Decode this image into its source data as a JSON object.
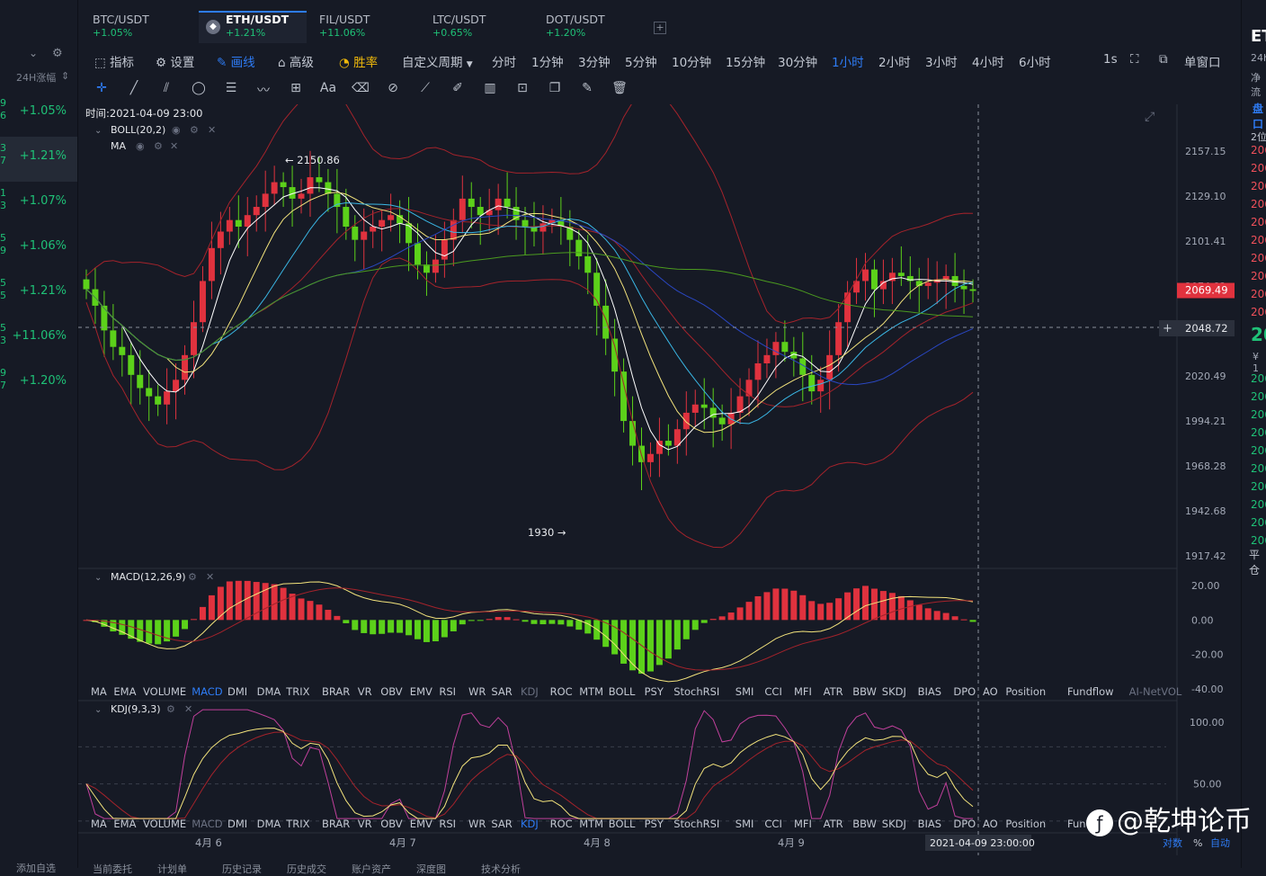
{
  "left_panel": {
    "sort_label": "24H涨幅",
    "rows": [
      {
        "edge": "9\n6",
        "change": "+1.05%"
      },
      {
        "edge": "3\n7",
        "change": "+1.21%",
        "selected": true
      },
      {
        "edge": "1\n3",
        "change": "+1.07%"
      },
      {
        "edge": "5\n9",
        "change": "+1.06%"
      },
      {
        "edge": "5\n5",
        "change": "+1.21%"
      },
      {
        "edge": "5\n3",
        "change": "+11.06%"
      },
      {
        "edge": "9\n7",
        "change": "+1.20%"
      }
    ],
    "footer": "添加自选"
  },
  "top_tabs": [
    {
      "name": "BTC/USDT",
      "change": "+1.05%"
    },
    {
      "name": "ETH/USDT",
      "change": "+1.21%",
      "active": true
    },
    {
      "name": "FIL/USDT",
      "change": "+11.06%"
    },
    {
      "name": "LTC/USDT",
      "change": "+0.65%"
    },
    {
      "name": "DOT/USDT",
      "change": "+1.20%"
    }
  ],
  "add_tab": "+",
  "toolbar": {
    "indicator": "指标",
    "settings": "设置",
    "draw": "画线",
    "advanced": "高级",
    "winrate": "胜率",
    "custom_period": "自定义周期",
    "periods": [
      "分时",
      "1分钟",
      "3分钟",
      "5分钟",
      "10分钟",
      "15分钟",
      "30分钟",
      "1小时",
      "2小时",
      "3小时",
      "4小时",
      "6小时"
    ],
    "active_period": "1小时",
    "interval": "1s",
    "single_window": "单窗口"
  },
  "draw_tools": [
    "crosshair",
    "line",
    "parallel",
    "circle",
    "hlines",
    "wave",
    "measure",
    "text",
    "eraser",
    "magnet",
    "ruler",
    "brush",
    "candles",
    "lock",
    "copy",
    "edit",
    "trash"
  ],
  "draw_text_tool": "Aa",
  "chart": {
    "time_label": "时间:2021-04-09 23:00",
    "boll_label": "BOLL(20,2)",
    "ma_label": "MA",
    "high_marker": "← 2150.86",
    "low_marker": "1930 →",
    "price_ticks": [
      "2157.15",
      "2129.10",
      "2101.41",
      "2074.82",
      "2048.72",
      "2020.49",
      "1994.21",
      "1968.28",
      "1942.68",
      "1917.42"
    ],
    "current_price": "2069.49",
    "crosshair_price": "2048.72",
    "macd_label": "MACD(12,26,9)",
    "macd_ticks": [
      "20.00",
      "0.00",
      "-20.00",
      "-40.00"
    ],
    "kdj_label": "KDJ(9,3,3)",
    "kdj_ticks": [
      "100.00",
      "50.00"
    ],
    "indicator_bar_1": [
      "MA",
      "EMA",
      "VOLUME",
      "MACD",
      "DMI",
      "DMA",
      "TRIX",
      "BRAR",
      "VR",
      "OBV",
      "EMV",
      "RSI",
      "WR",
      "SAR",
      "KDJ",
      "ROC",
      "MTM",
      "BOLL",
      "PSY",
      "StochRSI",
      "SMI",
      "CCI",
      "MFI",
      "ATR",
      "BBW",
      "SKDJ",
      "BIAS",
      "DPO",
      "AO",
      "Position",
      "Fundflow",
      "AI-NetVOL"
    ],
    "indicator_bar_1_active": "MACD",
    "indicator_bar_2": [
      "MA",
      "EMA",
      "VOLUME",
      "MACD",
      "DMI",
      "DMA",
      "TRIX",
      "BRAR",
      "VR",
      "OBV",
      "EMV",
      "RSI",
      "WR",
      "SAR",
      "KDJ",
      "ROC",
      "MTM",
      "BOLL",
      "PSY",
      "StochRSI",
      "SMI",
      "CCI",
      "MFI",
      "ATR",
      "BBW",
      "SKDJ",
      "BIAS",
      "DPO",
      "AO",
      "Position",
      "Fund"
    ],
    "indicator_bar_2_active": "KDJ",
    "dates": [
      "4月 6",
      "4月 7",
      "4月 8",
      "4月 9"
    ],
    "crosshair_time": "2021-04-09 23:00:00",
    "scale_log": "对数",
    "scale_pct": "%",
    "scale_auto": "自动"
  },
  "chart_data": {
    "type": "candlestick",
    "interval": "1h",
    "ohlc_approx_close": [
      2070,
      2060,
      2045,
      2035,
      2030,
      2018,
      2010,
      2005,
      2000,
      2008,
      2015,
      2030,
      2050,
      2075,
      2095,
      2105,
      2112,
      2108,
      2115,
      2120,
      2128,
      2135,
      2132,
      2125,
      2128,
      2138,
      2135,
      2128,
      2120,
      2108,
      2100,
      2105,
      2108,
      2112,
      2115,
      2110,
      2098,
      2085,
      2080,
      2088,
      2100,
      2112,
      2125,
      2120,
      2115,
      2118,
      2125,
      2120,
      2112,
      2108,
      2105,
      2110,
      2112,
      2108,
      2100,
      2090,
      2080,
      2060,
      2040,
      2020,
      1990,
      1975,
      1965,
      1970,
      1978,
      1975,
      1985,
      1995,
      2000,
      1998,
      1992,
      1988,
      1995,
      2005,
      2015,
      2025,
      2030,
      2038,
      2032,
      2028,
      2018,
      2008,
      2015,
      2030,
      2050,
      2068,
      2075,
      2082,
      2070,
      2075,
      2080,
      2078,
      2075,
      2072,
      2074,
      2076,
      2078,
      2072,
      2070,
      2069
    ],
    "high": 2150.86,
    "low": 1930,
    "current": 2069.49,
    "ylim": [
      1917.42,
      2157.15
    ],
    "macd": {
      "ylim": [
        -40,
        20
      ]
    },
    "kdj": {
      "ylim": [
        25,
        105
      ]
    }
  },
  "right_panel": {
    "top": "ET",
    "label1": "24h",
    "label2": "净流",
    "section": "盘口",
    "depth": "2位",
    "sell_prices": [
      "206",
      "206",
      "206",
      "206",
      "206",
      "206",
      "206",
      "206",
      "206",
      "206"
    ],
    "last_price": "20",
    "cny": "¥ 1",
    "buy_prices": [
      "206",
      "206",
      "206",
      "206",
      "206",
      "206",
      "206",
      "206",
      "206",
      "206"
    ],
    "flat": "平仓"
  },
  "bottom_tabs": [
    "当前委托",
    "计划单",
    "历史记录",
    "历史成交",
    "账户资产",
    "深度图",
    "技术分析"
  ],
  "watermark": "@乾坤论币"
}
